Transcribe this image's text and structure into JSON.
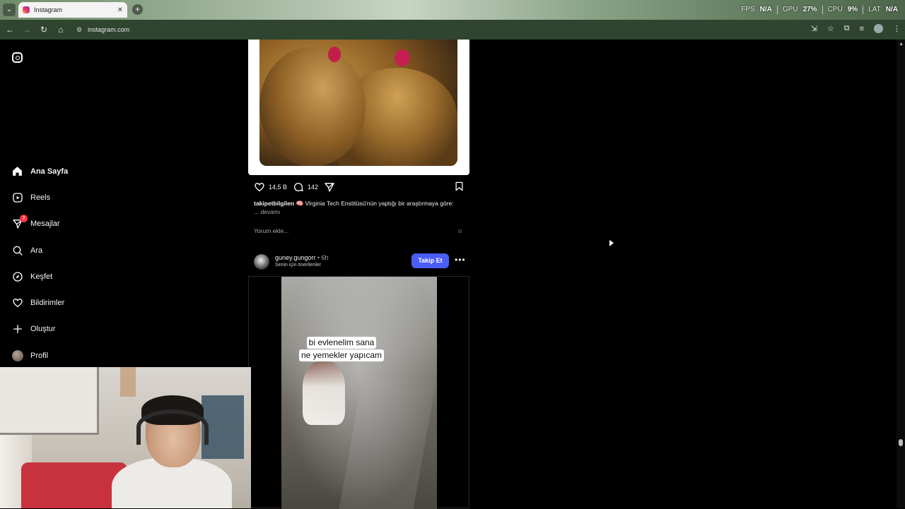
{
  "browser": {
    "tab_title": "Instagram",
    "tab_close": "✕",
    "new_tab": "+",
    "url": "instagram.com",
    "perf": {
      "fps_label": "FPS",
      "fps_value": "N/A",
      "gpu_label": "GPU",
      "gpu_value": "27%",
      "cpu_label": "CPU",
      "cpu_value": "9%",
      "lat_label": "LAT",
      "lat_value": "N/A"
    }
  },
  "sidebar": {
    "items": [
      {
        "label": "Ana Sayfa",
        "icon": "home-icon"
      },
      {
        "label": "Reels",
        "icon": "reels-icon"
      },
      {
        "label": "Mesajlar",
        "icon": "messages-icon",
        "badge": "2"
      },
      {
        "label": "Ara",
        "icon": "search-icon"
      },
      {
        "label": "Keşfet",
        "icon": "explore-icon"
      },
      {
        "label": "Bildirimler",
        "icon": "heart-icon"
      },
      {
        "label": "Oluştur",
        "icon": "plus-icon"
      },
      {
        "label": "Profil",
        "icon": "avatar"
      }
    ]
  },
  "post1": {
    "likes": "14,5 B",
    "comments": "142",
    "username": "takipetbilgilen",
    "caption": "Virginia Tech Enstitüsü'nün yaptığı bir araştırmaya göre:",
    "more": "... devamı",
    "comment_placeholder": "Yorum ekle..."
  },
  "post2": {
    "username": "guney.gungorr",
    "time": "• 6h",
    "subtitle": "Senin için önerilenler",
    "follow_label": "Takip Et",
    "more_label": "•••",
    "video_caption_line1": "bi evlenelim sana",
    "video_caption_line2": "ne yemekler yapıcam"
  },
  "colors": {
    "follow_button": "#4a5df9",
    "badge": "#ff3040",
    "background": "#000000"
  }
}
